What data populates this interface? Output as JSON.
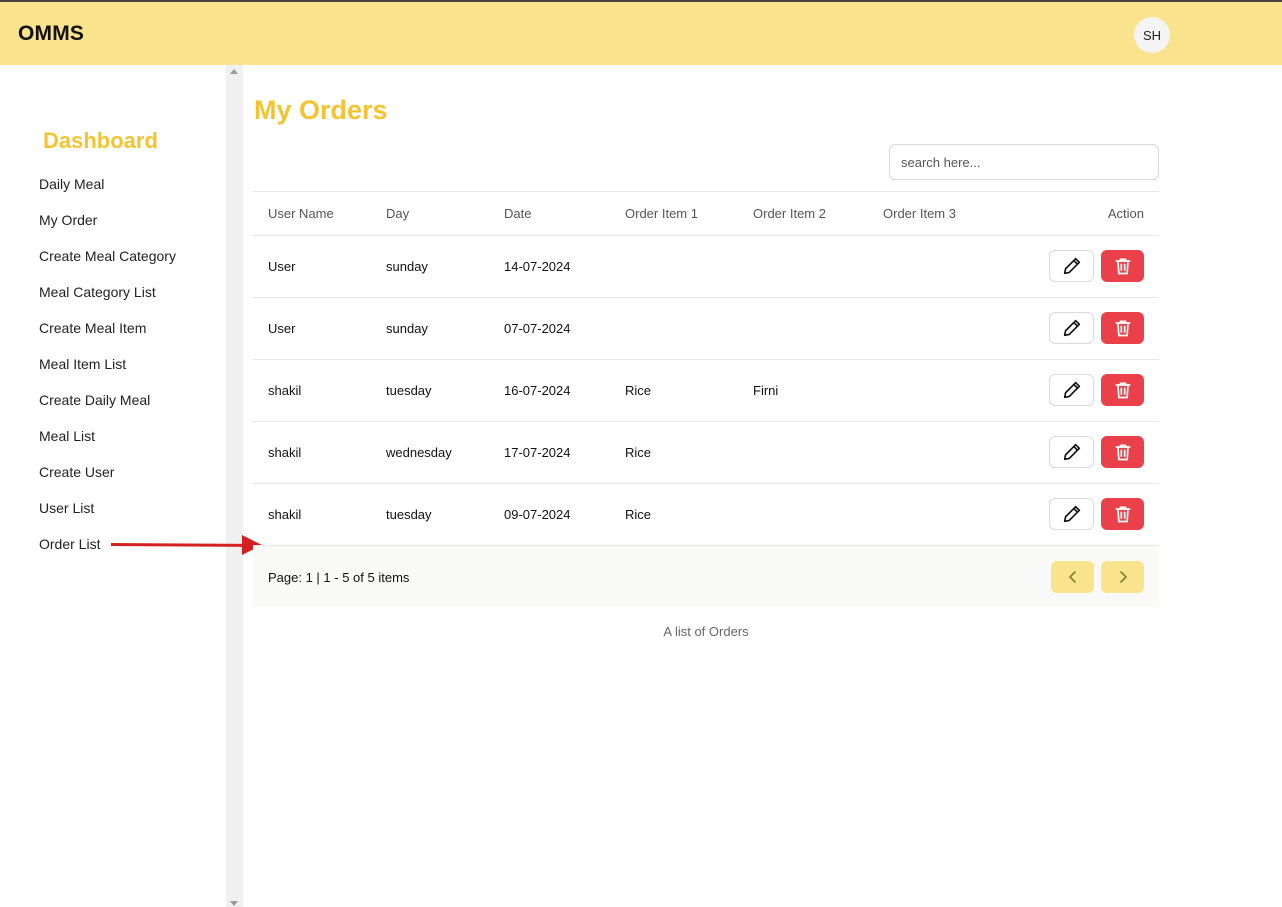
{
  "app": {
    "brand": "OMMS",
    "avatar_initials": "SH"
  },
  "sidebar": {
    "title": "Dashboard",
    "items": [
      {
        "label": "Daily Meal"
      },
      {
        "label": "My Order"
      },
      {
        "label": "Create Meal Category"
      },
      {
        "label": "Meal Category List"
      },
      {
        "label": "Create Meal Item"
      },
      {
        "label": "Meal Item List"
      },
      {
        "label": "Create Daily Meal"
      },
      {
        "label": "Meal List"
      },
      {
        "label": "Create User"
      },
      {
        "label": "User List"
      },
      {
        "label": "Order List"
      }
    ]
  },
  "main": {
    "title": "My Orders",
    "search": {
      "placeholder": "search here...",
      "value": ""
    },
    "columns": [
      "User Name",
      "Day",
      "Date",
      "Order Item 1",
      "Order Item 2",
      "Order Item 3",
      "Action"
    ],
    "rows": [
      {
        "user": "User",
        "day": "sunday",
        "date": "14-07-2024",
        "item1": "",
        "item2": "",
        "item3": ""
      },
      {
        "user": "User",
        "day": "sunday",
        "date": "07-07-2024",
        "item1": "",
        "item2": "",
        "item3": ""
      },
      {
        "user": "shakil",
        "day": "tuesday",
        "date": "16-07-2024",
        "item1": "Rice",
        "item2": "Firni",
        "item3": ""
      },
      {
        "user": "shakil",
        "day": "wednesday",
        "date": "17-07-2024",
        "item1": "Rice",
        "item2": "",
        "item3": ""
      },
      {
        "user": "shakil",
        "day": "tuesday",
        "date": "09-07-2024",
        "item1": "Rice",
        "item2": "",
        "item3": ""
      }
    ],
    "pagination": {
      "info": "Page: 1 | 1 - 5 of 5 items"
    },
    "caption": "A list of Orders"
  },
  "colors": {
    "header_bg": "#fae38d",
    "accent": "#f4c430",
    "delete": "#e9404a",
    "annotation_arrow": "#d42020"
  },
  "icons": {
    "edit": "pencil-icon",
    "delete": "trash-icon",
    "prev": "chevron-left-icon",
    "next": "chevron-right-icon"
  }
}
